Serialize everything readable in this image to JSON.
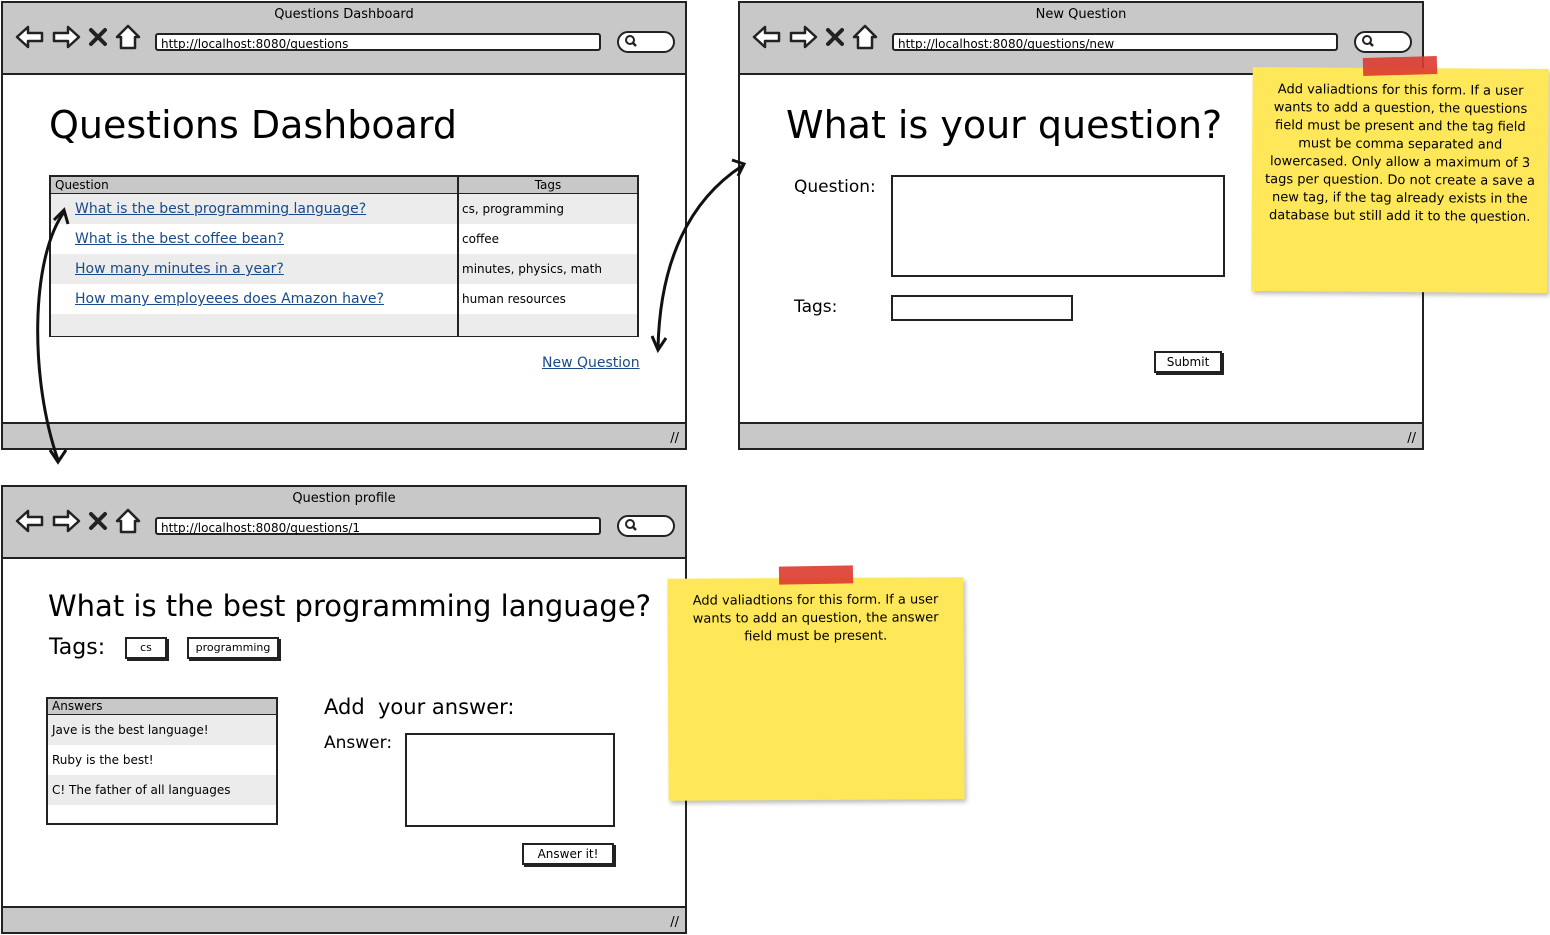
{
  "dashboard": {
    "window_title": "Questions Dashboard",
    "url": "http://localhost:8080/questions",
    "heading": "Questions Dashboard",
    "table": {
      "headers": [
        "Question",
        "Tags"
      ],
      "rows": [
        {
          "question": "What is the best programming language?",
          "tags": "cs, programming"
        },
        {
          "question": "What is the best coffee bean?",
          "tags": "coffee"
        },
        {
          "question": "How many minutes in a year?",
          "tags": "minutes, physics, math"
        },
        {
          "question": "How many employeees does Amazon have?",
          "tags": "human resources"
        }
      ]
    },
    "new_question_link": "New Question"
  },
  "new_question": {
    "window_title": "New Question",
    "url": "http://localhost:8080/questions/new",
    "heading": "What is your question?",
    "question_label": "Question:",
    "tags_label": "Tags:",
    "submit_label": "Submit",
    "note": "Add valiadtions for this form. If a user wants to add a question, the questions field must be present and the tag field must be comma separated and lowercased. Only allow a maximum of 3 tags per question. Do not create a save a new tag, if the tag already exists in the database but still add it to the question."
  },
  "profile": {
    "window_title": "Question profile",
    "url": "http://localhost:8080/questions/1",
    "heading": "What is the best programming language?",
    "tags_label": "Tags:",
    "tags": [
      "cs",
      "programming"
    ],
    "answers_header": "Answers",
    "answers": [
      "Jave is the best language!",
      "Ruby is the best!",
      "C! The father of all languages"
    ],
    "add_answer_heading": "Add  your answer:",
    "answer_label": "Answer:",
    "answer_button": "Answer it!",
    "note": "Add valiadtions for this form. If a user wants to add an question, the answer field must be present."
  },
  "icons": [
    "back-arrow-icon",
    "forward-arrow-icon",
    "close-icon",
    "home-icon",
    "search-icon",
    "resize-grip-icon"
  ],
  "colors": {
    "chrome": "#c8c8c8",
    "note": "#ffe75a",
    "tape": "#dd3b2f",
    "link": "#1a4a8a"
  }
}
